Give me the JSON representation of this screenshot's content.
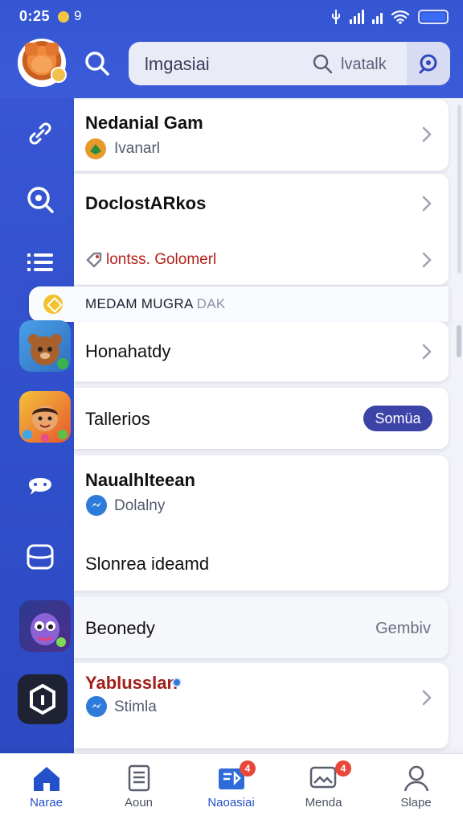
{
  "status": {
    "time": "0:25",
    "extra": "9"
  },
  "header": {
    "search_query": "lmgasiai",
    "search_hint": "lvatalk"
  },
  "list": {
    "card1": {
      "title": "Nedanial Gam",
      "subtitle": "Ivanarl"
    },
    "card2": {
      "title": "DoclostARkos",
      "subtitle": "lontss. Golomerl"
    },
    "banner": {
      "label": "MEDAM MUGRA",
      "suffix": " DAK"
    },
    "card3": {
      "title": "Honahatdy"
    },
    "card4": {
      "title": "Tallerios",
      "pill": "Somüa"
    },
    "card5": {
      "title": "Naualhlteean",
      "subtitle": "Dolalny",
      "second_title": "Slonrea ideamd"
    },
    "card6": {
      "title": "Beonedy",
      "note": "Gembiv"
    },
    "card7": {
      "title": "Yablusslan",
      "subtitle": "Stimla"
    }
  },
  "bottom_nav": {
    "items": [
      {
        "label": "Narae"
      },
      {
        "label": "Aoun"
      },
      {
        "label": "Naoasiai",
        "badge": "4"
      },
      {
        "label": "Menda",
        "badge": "4"
      },
      {
        "label": "Slape"
      }
    ]
  },
  "colors": {
    "primary": "#3556d3",
    "accent": "#2450c9",
    "badge": "#e8473b",
    "pill": "#3c44a8"
  }
}
